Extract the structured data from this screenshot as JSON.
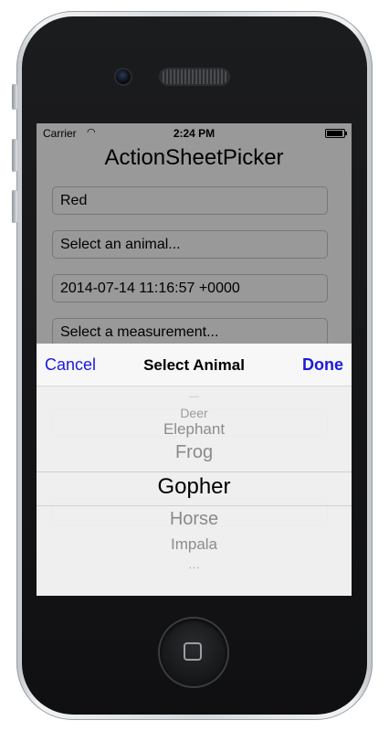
{
  "status_bar": {
    "carrier": "Carrier",
    "time": "2:24 PM"
  },
  "app": {
    "title": "ActionSheetPicker",
    "fields": [
      "Red",
      "Select an animal...",
      "2014-07-14 11:16:57 +0000",
      "Select a measurement..."
    ]
  },
  "action_sheet": {
    "cancel_label": "Cancel",
    "title": "Select Animal",
    "done_label": "Done",
    "picker_items": [
      "Deer",
      "Elephant",
      "Frog",
      "Gopher",
      "Horse",
      "Impala"
    ],
    "selected": "Gopher"
  },
  "colors": {
    "accent": "#1a1adb"
  }
}
